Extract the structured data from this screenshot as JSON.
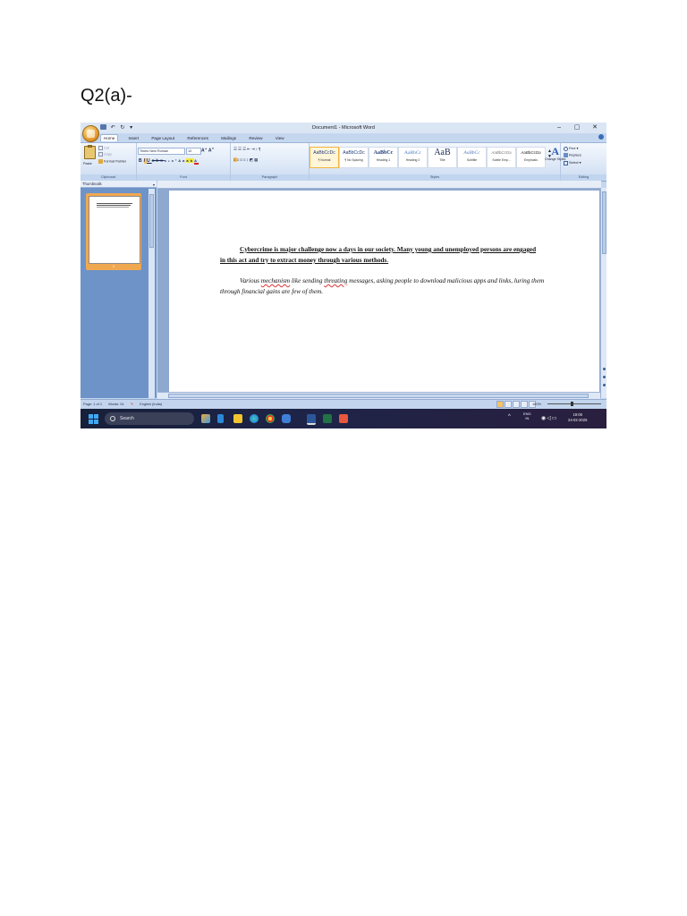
{
  "page_heading": "Q2(a)-",
  "window": {
    "title": "Document1 - Microsoft Word",
    "controls": [
      "–",
      "▢",
      "✕"
    ]
  },
  "tabs": [
    "Home",
    "Insert",
    "Page Layout",
    "References",
    "Mailings",
    "Review",
    "View"
  ],
  "ribbon": {
    "clipboard": {
      "paste": "Paste",
      "cut": "Cut",
      "copy": "Copy",
      "format_painter": "Format Painter",
      "label": "Clipboard"
    },
    "font": {
      "name": "Times New Roman",
      "size": "10",
      "label": "Font"
    },
    "paragraph": {
      "label": "Paragraph"
    },
    "styles": {
      "label": "Styles",
      "items": [
        {
          "preview": "AaBbCcDc",
          "name": "¶ Normal"
        },
        {
          "preview": "AaBbCcDc",
          "name": "¶ No Spacing"
        },
        {
          "preview": "AaBbCc",
          "name": "Heading 1"
        },
        {
          "preview": "AaBbCc",
          "name": "Heading 2"
        },
        {
          "preview": "AaB",
          "name": "Title"
        },
        {
          "preview": "AaBbCc",
          "name": "Subtitle"
        },
        {
          "preview": "AaBbCcDa",
          "name": "Subtle Emp..."
        },
        {
          "preview": "AaBbCcDa",
          "name": "Emphasis"
        }
      ],
      "change_styles": "Change Styles"
    },
    "editing": {
      "find": "Find",
      "replace": "Replace",
      "select": "Select",
      "label": "Editing"
    }
  },
  "nav_pane": {
    "dropdown": "Thumbnails",
    "page_number": "1"
  },
  "document": {
    "para1": "Cybercrime is major challenge now a days in our society. Many young and unemployed persons are engaged in this act and try to extract money through various methods",
    "para1_end": ".",
    "para2_a": "Various ",
    "para2_sq1": "mechanism",
    "para2_b": " like sending ",
    "para2_sq2": "threating",
    "para2_c": " messages, asking people to download malicious apps and links, luring them through financial gains are few of them."
  },
  "status_bar": {
    "page": "Page: 1 of 1",
    "words": "Words: 51",
    "language": "English (India)",
    "zoom": "100%"
  },
  "taskbar": {
    "search_placeholder": "Search",
    "lang_top": "ENG",
    "lang_bottom": "IN",
    "time": "19:06",
    "date": "24-02-2025"
  }
}
